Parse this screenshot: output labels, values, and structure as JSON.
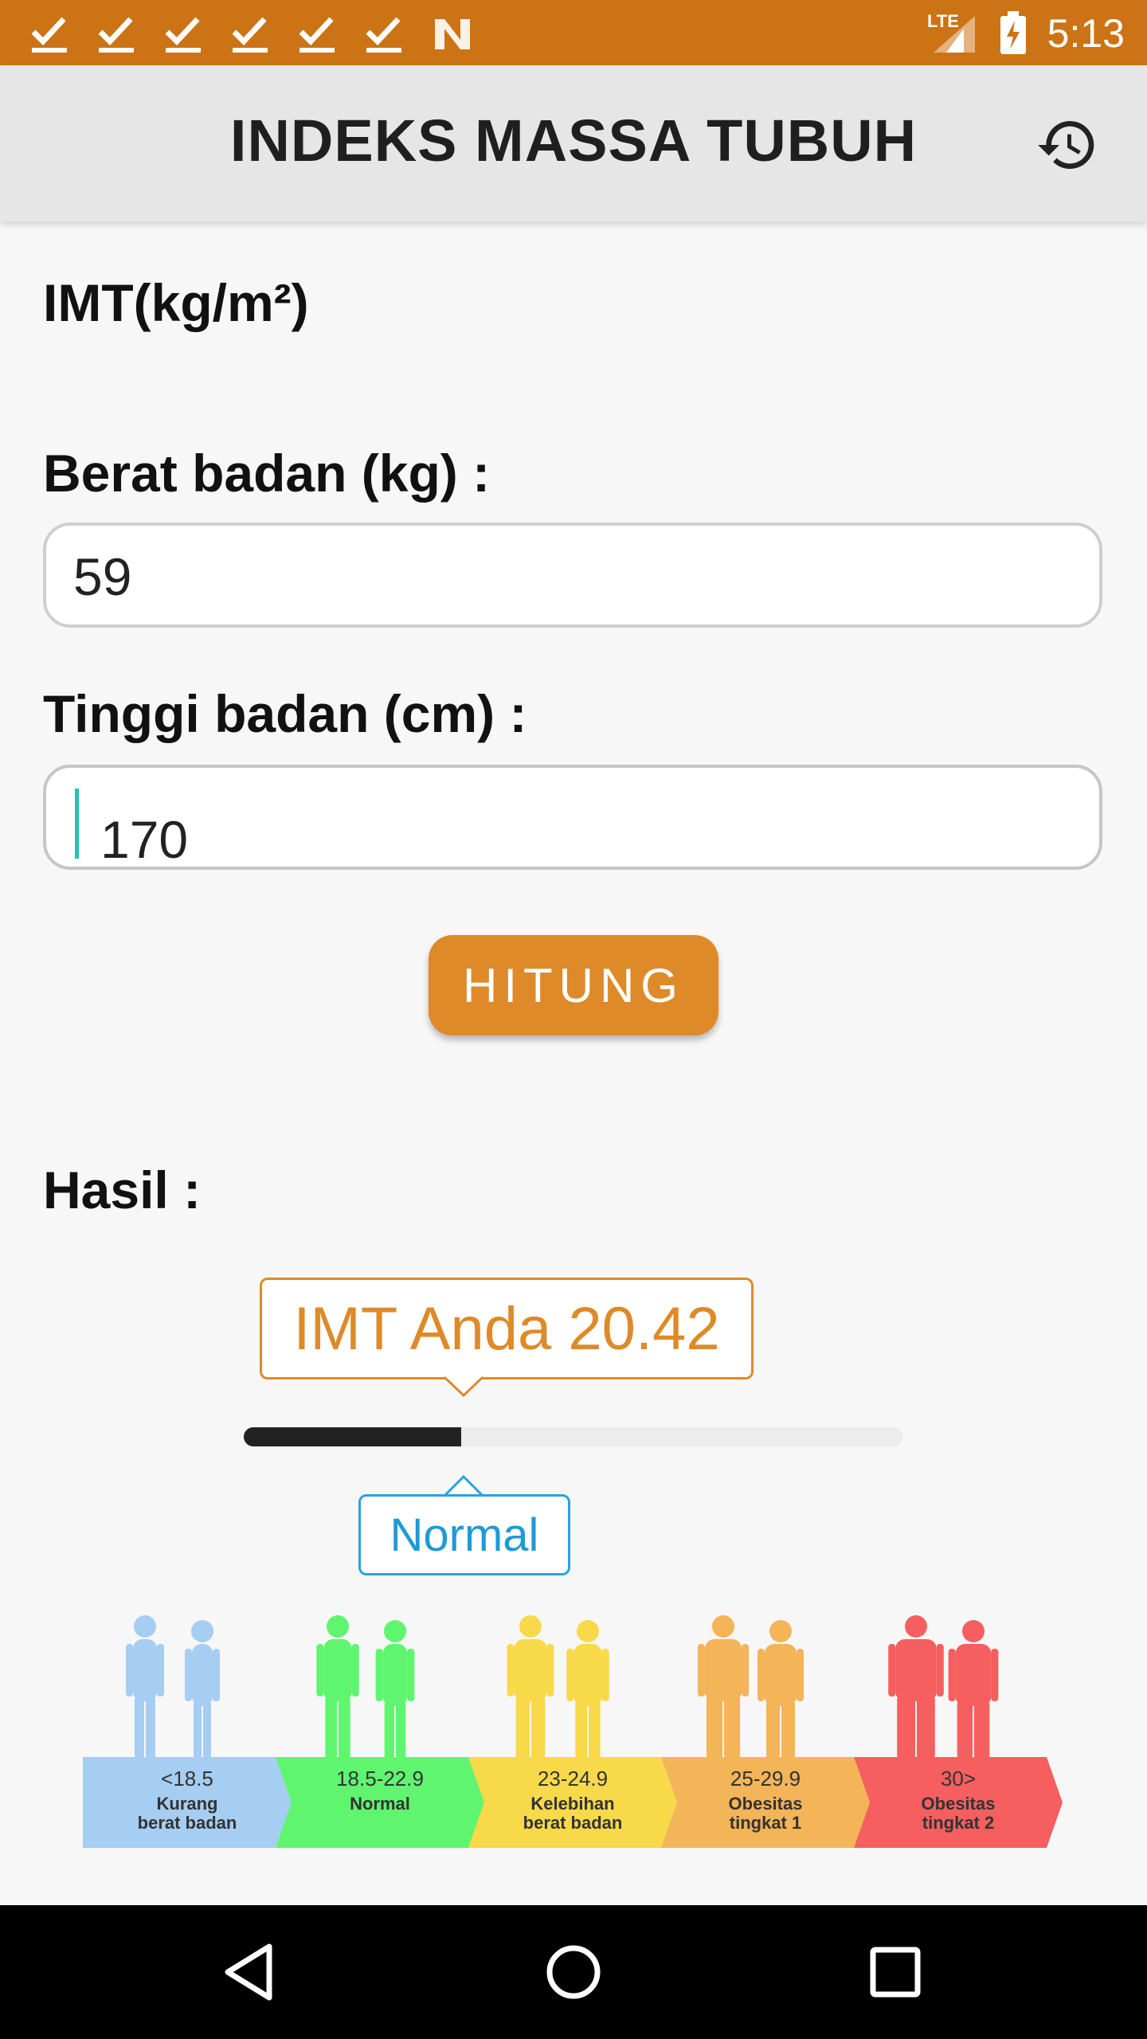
{
  "status_bar": {
    "time": "5:13",
    "network": "LTE",
    "notification_icons": [
      "check-icon",
      "check-icon",
      "check-icon",
      "check-icon",
      "check-icon",
      "check-icon",
      "n-icon"
    ],
    "color": "#cc7315"
  },
  "app_bar": {
    "title": "INDEKS MASSA TUBUH",
    "history_icon": "history-icon"
  },
  "form": {
    "unit_heading": "IMT(kg/m²)",
    "weight_label": "Berat badan (kg) :",
    "weight_value": "59",
    "height_label": "Tinggi badan (cm) :",
    "height_value": "170",
    "calculate_button": "HITUNG",
    "accent_color": "#de8a28"
  },
  "result": {
    "heading": "Hasil :",
    "bmi_text": "IMT Anda 20.42",
    "bmi_value": 20.42,
    "progress_fraction": 0.33,
    "category": "Normal",
    "category_color": "#1e9ad6"
  },
  "chart": {
    "categories": [
      {
        "range": "<18.5",
        "line1": "Kurang",
        "line2": "berat badan",
        "color": "#a6cdf2"
      },
      {
        "range": "18.5-22.9",
        "line1": "Normal",
        "line2": "",
        "color": "#5ff56f"
      },
      {
        "range": "23-24.9",
        "line1": "Kelebihan",
        "line2": "berat badan",
        "color": "#f8d949"
      },
      {
        "range": "25-29.9",
        "line1": "Obesitas",
        "line2": "tingkat 1",
        "color": "#f4b458"
      },
      {
        "range": "30>",
        "line1": "Obesitas",
        "line2": "tingkat 2",
        "color": "#f55f5f"
      }
    ]
  },
  "nav_bar": {
    "back_icon": "back-icon",
    "home_icon": "home-icon",
    "recents_icon": "recents-icon"
  }
}
